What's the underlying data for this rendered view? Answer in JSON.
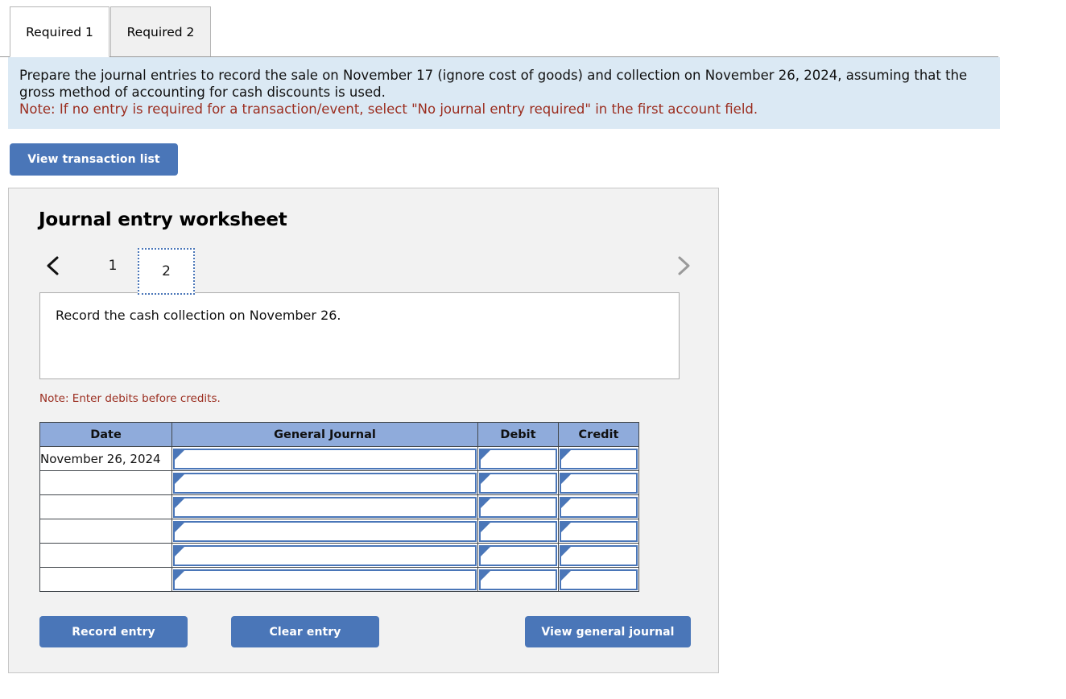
{
  "tabs": [
    {
      "label": "Required 1",
      "active": true
    },
    {
      "label": "Required 2",
      "active": false
    }
  ],
  "instructions": {
    "line1": "Prepare the journal entries to record the sale on November 17 (ignore cost of goods) and collection on November 26, 2024, assuming that the gross method of accounting for cash discounts is used.",
    "note": "Note: If no entry is required for a transaction/event, select \"No journal entry required\" in the first account field."
  },
  "toolbar": {
    "view_transaction_list_label": "View transaction list"
  },
  "worksheet": {
    "title": "Journal entry worksheet",
    "pager": {
      "prev_icon": "chevron-left-icon",
      "next_icon": "chevron-right-icon",
      "pages": [
        "1",
        "2"
      ],
      "selected_page": "2"
    },
    "description": "Record the cash collection on November 26.",
    "debit_note": "Note: Enter debits before credits.",
    "table": {
      "columns": [
        "Date",
        "General Journal",
        "Debit",
        "Credit"
      ],
      "rows": [
        {
          "date": "November 26, 2024",
          "general_journal": "",
          "debit": "",
          "credit": ""
        },
        {
          "date": "",
          "general_journal": "",
          "debit": "",
          "credit": ""
        },
        {
          "date": "",
          "general_journal": "",
          "debit": "",
          "credit": ""
        },
        {
          "date": "",
          "general_journal": "",
          "debit": "",
          "credit": ""
        },
        {
          "date": "",
          "general_journal": "",
          "debit": "",
          "credit": ""
        },
        {
          "date": "",
          "general_journal": "",
          "debit": "",
          "credit": ""
        }
      ]
    },
    "buttons": {
      "record_entry": "Record entry",
      "clear_entry": "Clear entry",
      "view_general_journal": "View general journal"
    }
  },
  "colors": {
    "accent_blue": "#4a76b8",
    "table_header_blue": "#8fabdb",
    "banner_blue": "#dbe9f4",
    "note_red": "#9b2d1f",
    "panel_gray": "#f2f2f2"
  }
}
